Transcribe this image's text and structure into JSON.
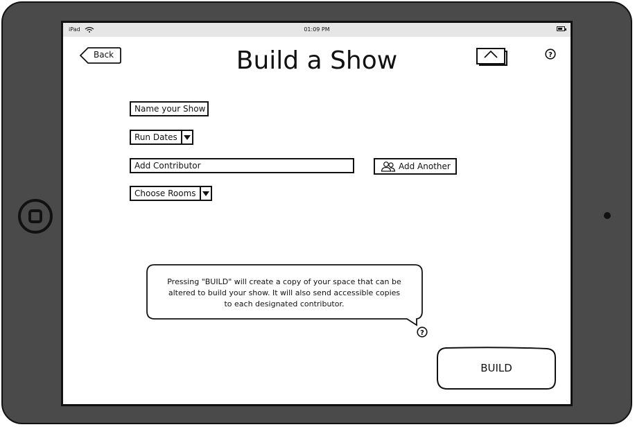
{
  "status_bar": {
    "device": "iPad",
    "time": "01:09 PM"
  },
  "header": {
    "back_label": "Back",
    "title": "Build a Show"
  },
  "form": {
    "show_name_placeholder": "Name your Show",
    "run_dates_label": "Run Dates",
    "contributor_placeholder": "Add Contributor",
    "add_another_label": "Add Another",
    "rooms_label": "Choose Rooms"
  },
  "callout": {
    "lines": [
      "Pressing \"BUILD\" will create a copy of your space that can be",
      "altered to build your show.  It will also send accessible copies",
      "to each designated contributor."
    ]
  },
  "actions": {
    "build_label": "BUILD"
  },
  "icons": {
    "wifi": "wifi-icon",
    "battery": "battery-icon",
    "home": "home-icon",
    "help": "help-icon",
    "contributors": "people-icon",
    "dropdown": "chevron-down-icon"
  }
}
